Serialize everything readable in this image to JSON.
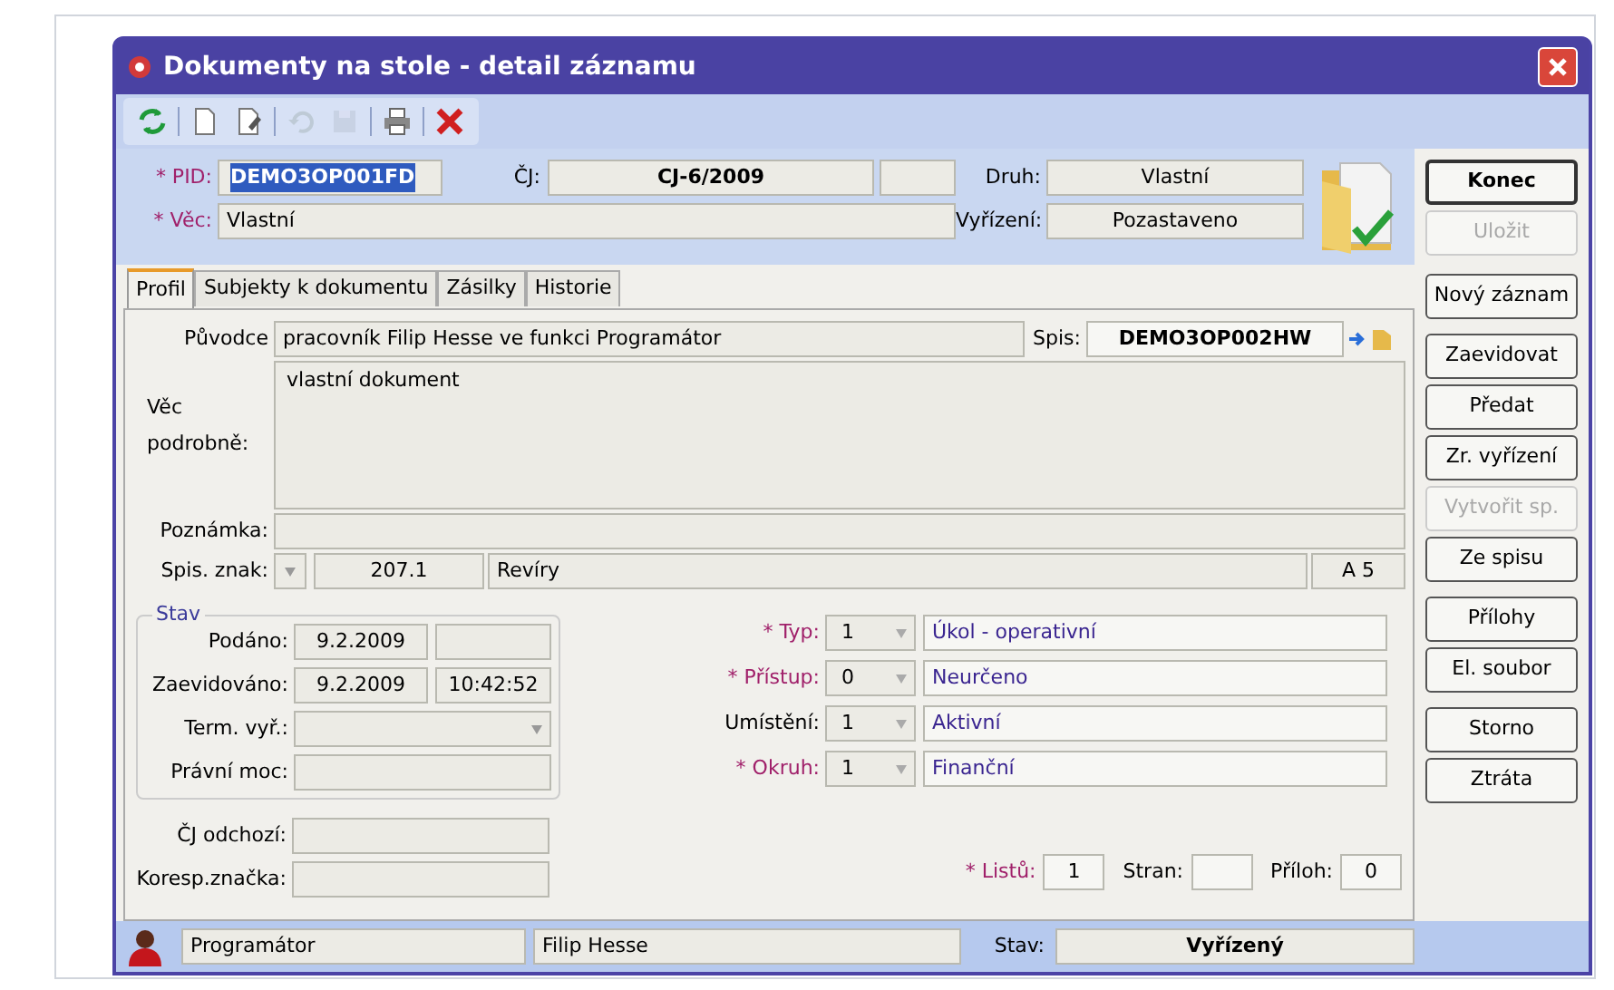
{
  "window": {
    "title": "Dokumenty na stole - detail záznamu"
  },
  "toolbar": [
    {
      "kind": "refresh",
      "disabled": false
    },
    {
      "kind": "new",
      "disabled": false
    },
    {
      "kind": "edit",
      "disabled": false
    },
    {
      "kind": "undo",
      "disabled": true
    },
    {
      "kind": "save",
      "disabled": true
    },
    {
      "kind": "print",
      "disabled": false
    },
    {
      "kind": "delete",
      "disabled": false
    }
  ],
  "header": {
    "pid": {
      "label": "* PID:",
      "value": "DEMO3OP001FD",
      "required": true,
      "selected": true
    },
    "cj": {
      "label": "ČJ:",
      "value": "CJ-6/2009"
    },
    "druh": {
      "label": "Druh:",
      "value": "Vlastní"
    },
    "vec": {
      "label": "* Věc:",
      "value": "Vlastní",
      "required": true
    },
    "vyrizeni": {
      "label": "Vyřízení:",
      "value": "Pozastaveno"
    }
  },
  "buttons": [
    {
      "label": "Konec",
      "disabled": false,
      "default": true
    },
    {
      "label": "Uložit",
      "disabled": true,
      "default": false
    },
    {
      "label": "Nový záznam",
      "disabled": false,
      "default": false
    },
    {
      "label": "Zaevidovat",
      "disabled": false,
      "default": false
    },
    {
      "label": "Předat",
      "disabled": false,
      "default": false
    },
    {
      "label": "Zr. vyřízení",
      "disabled": false,
      "default": false
    },
    {
      "label": "Vytvořit sp.",
      "disabled": true,
      "default": false
    },
    {
      "label": "Ze spisu",
      "disabled": false,
      "default": false
    },
    {
      "label": "Přílohy",
      "disabled": false,
      "default": false
    },
    {
      "label": "El. soubor",
      "disabled": false,
      "default": false
    },
    {
      "label": "Storno",
      "disabled": false,
      "default": false
    },
    {
      "label": "Ztráta",
      "disabled": false,
      "default": false
    }
  ],
  "tabs": [
    {
      "label": "Profil",
      "selected": true
    },
    {
      "label": "Subjekty k dokumentu",
      "selected": false
    },
    {
      "label": "Zásilky",
      "selected": false
    },
    {
      "label": "Historie",
      "selected": false
    }
  ],
  "profile": {
    "puvodce": {
      "label": "Původce",
      "value": "pracovník Filip Hesse ve funkci Programátor"
    },
    "spis": {
      "label": "Spis:",
      "value": "DEMO3OP002HW"
    },
    "vec_podrobne": {
      "label": "Věc podrobně:",
      "value": "vlastní dokument"
    },
    "poznamka": {
      "label": "Poznámka:"
    },
    "spis_znak": {
      "label": "Spis. znak:",
      "code": "207.1",
      "name": "Revíry",
      "format": "A 5"
    },
    "stav": {
      "title": "Stav",
      "rows": [
        {
          "kind": "datetime",
          "label": "Podáno:",
          "date": "9.2.2009"
        },
        {
          "kind": "datetime",
          "label": "Zaevidováno:",
          "date": "9.2.2009",
          "time": "10:42:52"
        },
        {
          "kind": "dropdown",
          "label": "Term. vyř.:"
        },
        {
          "kind": "plain",
          "label": "Právní moc:"
        }
      ]
    },
    "cj_odchozi": {
      "label": "ČJ odchozí:"
    },
    "koresp": {
      "label": "Koresp.značka:"
    },
    "classifiers": [
      {
        "label": "* Typ:",
        "required": true,
        "code": "1",
        "value": "Úkol - operativní"
      },
      {
        "label": "* Přístup:",
        "required": true,
        "code": "0",
        "value": "Neurčeno"
      },
      {
        "label": "Umístění:",
        "required": false,
        "code": "1",
        "value": "Aktivní"
      },
      {
        "label": "* Okruh:",
        "required": true,
        "code": "1",
        "value": "Finanční"
      }
    ],
    "counts": [
      {
        "label": "* Listů:",
        "required": true,
        "value": "1"
      },
      {
        "label": "Stran:",
        "required": false
      },
      {
        "label": "Příloh:",
        "required": false,
        "value": "0"
      }
    ]
  },
  "status_bar": {
    "role": "Programátor",
    "user": "Filip Hesse",
    "state_label": "Stav:",
    "state": "Vyřízený"
  }
}
